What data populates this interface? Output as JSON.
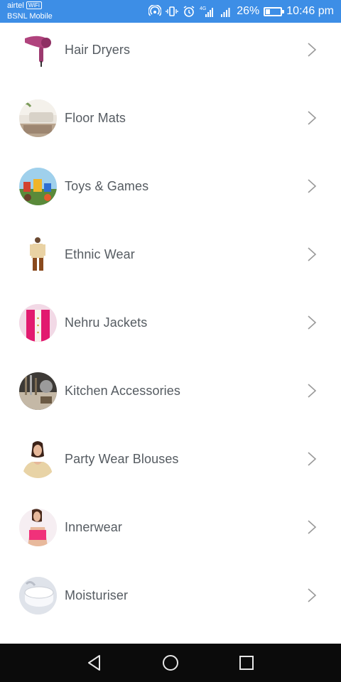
{
  "status_bar": {
    "carrier_primary": "airtel",
    "wifi_badge": "WiFi",
    "carrier_secondary": "BSNL Mobile",
    "battery_percent": "26%",
    "time": "10:46 pm",
    "network_type": "4G",
    "background_color": "#3d8ee6"
  },
  "categories": [
    {
      "label": "Hair Dryers",
      "icon": "hair-dryer-image"
    },
    {
      "label": "Floor Mats",
      "icon": "floor-mat-image"
    },
    {
      "label": "Toys & Games",
      "icon": "toys-image"
    },
    {
      "label": "Ethnic Wear",
      "icon": "ethnic-wear-image"
    },
    {
      "label": "Nehru Jackets",
      "icon": "nehru-jacket-image"
    },
    {
      "label": "Kitchen Accessories",
      "icon": "kitchen-image"
    },
    {
      "label": "Party Wear Blouses",
      "icon": "blouse-image"
    },
    {
      "label": "Innerwear",
      "icon": "innerwear-image"
    },
    {
      "label": "Moisturiser",
      "icon": "moisturiser-image"
    }
  ],
  "nav_bar": {
    "back": "back-icon",
    "home": "home-icon",
    "recents": "recents-icon"
  }
}
